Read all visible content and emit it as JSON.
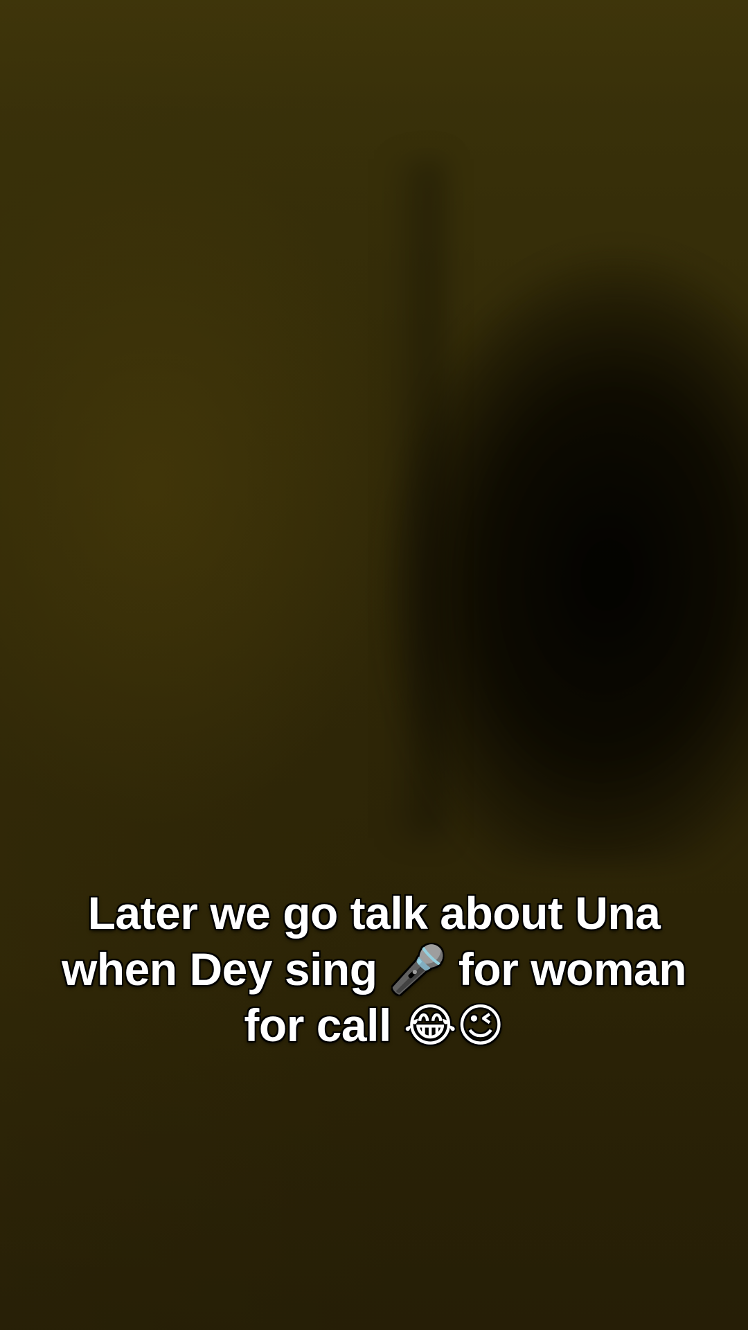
{
  "caption": {
    "line1": "Later we go talk about Una",
    "line2": "when Dey sing 🎤 for woman",
    "line3": "for call 😂😉"
  }
}
